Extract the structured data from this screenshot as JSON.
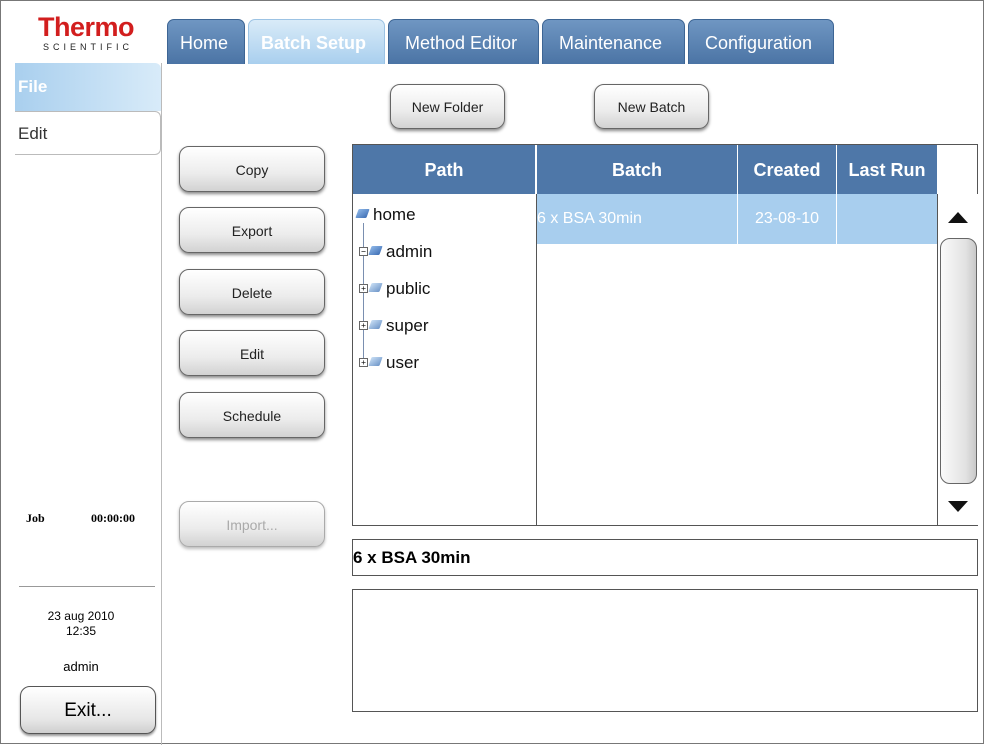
{
  "logo": {
    "main": "Thermo",
    "sub": "SCIENTIFIC"
  },
  "tabs": [
    {
      "label": "Home"
    },
    {
      "label": "Batch Setup"
    },
    {
      "label": "Method Editor"
    },
    {
      "label": "Maintenance"
    },
    {
      "label": "Configuration"
    }
  ],
  "menu": {
    "file": "File",
    "edit": "Edit"
  },
  "status": {
    "job_label": "Job",
    "job_time": "00:00:00",
    "date": "23 aug 2010",
    "time": "12:35",
    "user": "admin"
  },
  "exit_label": "Exit...",
  "toolbar": {
    "new_folder": "New Folder",
    "new_batch": "New Batch"
  },
  "actions": {
    "copy": "Copy",
    "export": "Export",
    "delete": "Delete",
    "edit": "Edit",
    "schedule": "Schedule",
    "import": "Import..."
  },
  "table": {
    "headers": {
      "path": "Path",
      "batch": "Batch",
      "created": "Created",
      "last_run": "Last Run"
    },
    "tree": [
      "home",
      "admin",
      "public",
      "super",
      "user"
    ],
    "rows": [
      {
        "batch": "6 x BSA 30min",
        "created": "23-08-10",
        "last_run": ""
      }
    ]
  },
  "selected_batch": "6 x BSA 30min",
  "colors": {
    "tab": "#4b74a5",
    "tab_active": "#a9cfee",
    "header": "#4e77a8",
    "selection": "#a8ceee",
    "brand": "#d21e1e"
  }
}
